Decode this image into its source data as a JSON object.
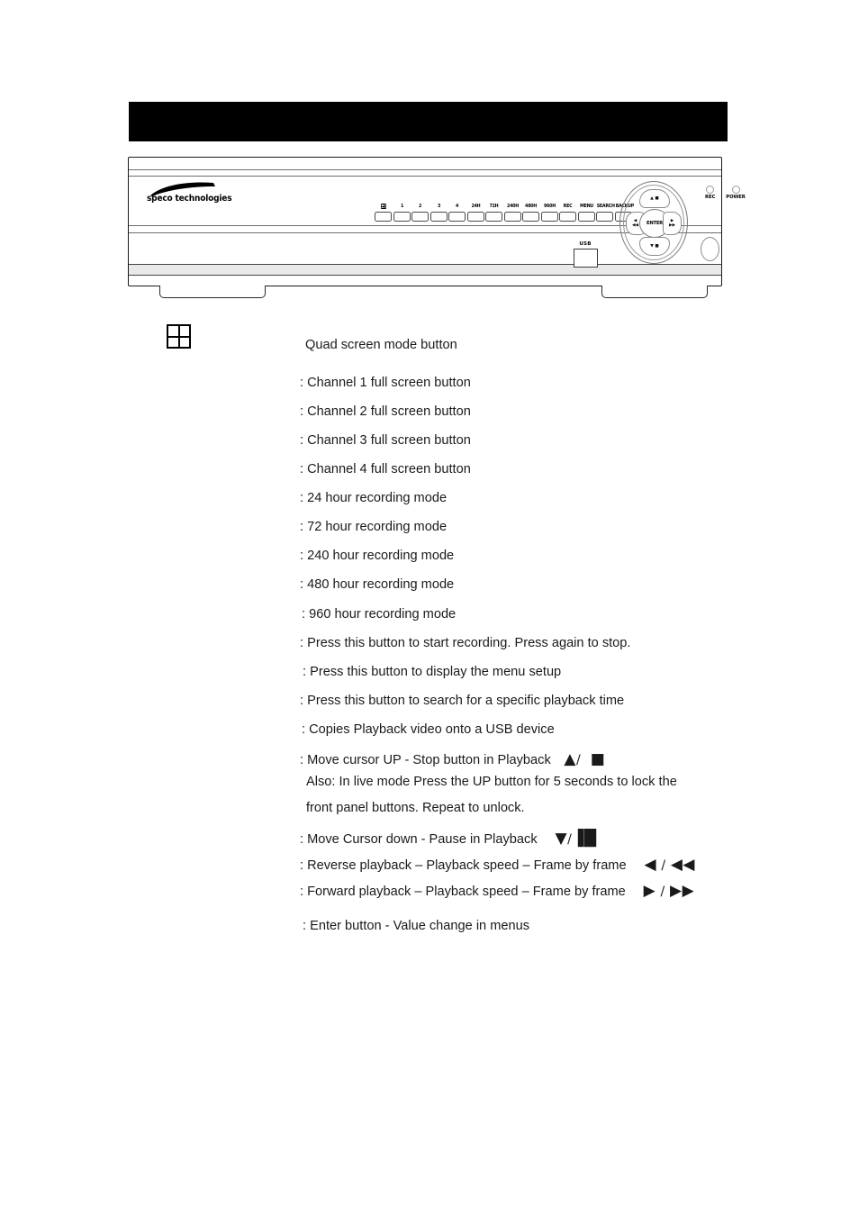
{
  "page": {
    "header_bar_color": "#000000",
    "background_color": "#ffffff"
  },
  "device": {
    "name": "speco technologies",
    "logo_text": "speco technologies",
    "usb_label": "USB",
    "panel_keys": [
      {
        "label": "",
        "icon": "quad-grid-icon"
      },
      {
        "label": "1"
      },
      {
        "label": "2"
      },
      {
        "label": "3"
      },
      {
        "label": "4"
      },
      {
        "label": "24H"
      },
      {
        "label": "72H"
      },
      {
        "label": "240H"
      },
      {
        "label": "480H"
      },
      {
        "label": "960H"
      },
      {
        "label": "REC"
      },
      {
        "label": "MENU"
      },
      {
        "label": "SEARCH"
      },
      {
        "label": "BACKUP"
      }
    ],
    "nav_pad": {
      "enter": "ENTER",
      "up_top": "▲ ■",
      "up_bottom": "",
      "down_top": "▼ ■",
      "left_top": "◀",
      "left_bottom": "◀◀",
      "right_top": "▶",
      "right_bottom": "▶▶"
    },
    "leds": [
      {
        "label": "REC"
      },
      {
        "label": "POWER"
      }
    ]
  },
  "legend": {
    "quad_icon_label": "quad-screen-grid-icon",
    "items": [
      {
        "text": "Quad screen mode button"
      },
      {
        "text": ": Channel 1 full screen button"
      },
      {
        "text": ": Channel 2 full screen button"
      },
      {
        "text": ": Channel 3 full screen button"
      },
      {
        "text": ": Channel 4 full screen button"
      },
      {
        "text": ": 24 hour recording mode"
      },
      {
        "text": ": 72 hour recording mode"
      },
      {
        "text": ": 240 hour recording mode"
      },
      {
        "text": ": 480 hour recording mode"
      },
      {
        "text": ": 960 hour recording mode"
      },
      {
        "text": ": Press this button to start recording. Press again to stop."
      },
      {
        "text": ": Press this button to display the menu setup"
      },
      {
        "text": ": Press this button to search for a specific playback time"
      },
      {
        "text": ": Copies Playback video onto a USB device"
      },
      {
        "text": ": Move cursor UP   -   Stop button in Playback"
      },
      {
        "text": "Also: In live mode Press the UP button for 5 seconds to lock the"
      },
      {
        "text": "front panel buttons. Repeat to unlock."
      },
      {
        "text": ": Move Cursor down   -   Pause in Playback"
      },
      {
        "text": ": Reverse playback – Playback speed – Frame by frame"
      },
      {
        "text": ": Forward playback – Playback speed – Frame by frame"
      },
      {
        "text": ": Enter button - Value change in menus"
      }
    ],
    "symbols": {
      "up_stop": "▲",
      "up_stop_sep": "/",
      "stop_square": "■",
      "down_pause": "▼",
      "down_pause_sep": "/",
      "pause_bars": "▐█",
      "reverse": "◀",
      "reverse_sep": "/",
      "rewind": "◀◀",
      "forward": "▶",
      "forward_sep": "/",
      "fast_forward": "▶▶"
    }
  }
}
